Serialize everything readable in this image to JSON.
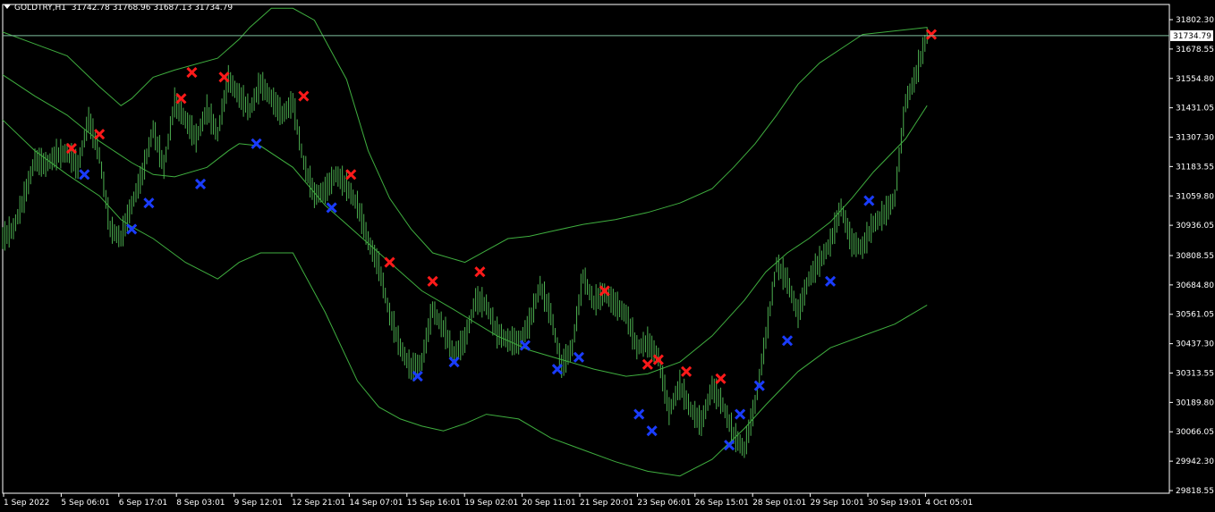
{
  "header": {
    "symbol": "GOLDTRY,H1",
    "ohlc": "31742.78 31768.96 31687.13 31734.79"
  },
  "colors": {
    "background": "#000000",
    "bars": "#4caf50",
    "bands": "#3fae3f",
    "sell_marker": "#ff1a1a",
    "buy_marker": "#1a3cff",
    "axis": "#ffffff",
    "price_line": "#7fbf9f"
  },
  "chart_data": {
    "type": "line",
    "title": "",
    "xlabel": "",
    "ylabel": "",
    "ylim": [
      29818.55,
      31802.3
    ],
    "current_price": "31734.79",
    "y_ticks": [
      "31802.30",
      "31678.55",
      "31554.80",
      "31431.05",
      "31307.30",
      "31183.55",
      "31059.80",
      "30936.05",
      "30808.55",
      "30684.80",
      "30561.05",
      "30437.30",
      "30313.55",
      "30189.80",
      "30066.05",
      "29942.30",
      "29818.55"
    ],
    "x_ticks": [
      "1 Sep 2022",
      "5 Sep 06:01",
      "6 Sep 17:01",
      "8 Sep 03:01",
      "9 Sep 12:01",
      "12 Sep 21:01",
      "14 Sep 07:01",
      "15 Sep 16:01",
      "19 Sep 02:01",
      "20 Sep 11:01",
      "21 Sep 20:01",
      "23 Sep 06:01",
      "26 Sep 15:01",
      "28 Sep 01:01",
      "29 Sep 10:01",
      "30 Sep 19:01",
      "4 Oct 05:01"
    ],
    "x_count": 160,
    "price": [
      [
        0,
        30880
      ],
      [
        5,
        30920
      ],
      [
        10,
        31050
      ],
      [
        15,
        31210
      ],
      [
        20,
        31190
      ],
      [
        25,
        31230
      ],
      [
        30,
        31240
      ],
      [
        35,
        31180
      ],
      [
        40,
        31380
      ],
      [
        45,
        31230
      ],
      [
        50,
        30920
      ],
      [
        55,
        30880
      ],
      [
        60,
        31020
      ],
      [
        65,
        31150
      ],
      [
        70,
        31340
      ],
      [
        75,
        31180
      ],
      [
        80,
        31450
      ],
      [
        85,
        31380
      ],
      [
        90,
        31300
      ],
      [
        95,
        31420
      ],
      [
        100,
        31320
      ],
      [
        105,
        31550
      ],
      [
        110,
        31480
      ],
      [
        115,
        31420
      ],
      [
        120,
        31530
      ],
      [
        125,
        31470
      ],
      [
        130,
        31400
      ],
      [
        135,
        31450
      ],
      [
        140,
        31200
      ],
      [
        145,
        31060
      ],
      [
        150,
        31080
      ],
      [
        155,
        31150
      ],
      [
        160,
        31100
      ],
      [
        165,
        31020
      ],
      [
        170,
        30870
      ],
      [
        175,
        30760
      ],
      [
        180,
        30560
      ],
      [
        185,
        30420
      ],
      [
        190,
        30330
      ],
      [
        195,
        30360
      ],
      [
        200,
        30580
      ],
      [
        205,
        30500
      ],
      [
        210,
        30390
      ],
      [
        215,
        30450
      ],
      [
        220,
        30620
      ],
      [
        225,
        30600
      ],
      [
        230,
        30480
      ],
      [
        235,
        30450
      ],
      [
        240,
        30440
      ],
      [
        245,
        30520
      ],
      [
        250,
        30680
      ],
      [
        255,
        30560
      ],
      [
        260,
        30340
      ],
      [
        265,
        30420
      ],
      [
        270,
        30720
      ],
      [
        275,
        30610
      ],
      [
        280,
        30650
      ],
      [
        285,
        30600
      ],
      [
        290,
        30560
      ],
      [
        295,
        30420
      ],
      [
        300,
        30440
      ],
      [
        305,
        30380
      ],
      [
        310,
        30150
      ],
      [
        315,
        30260
      ],
      [
        320,
        30160
      ],
      [
        325,
        30100
      ],
      [
        330,
        30250
      ],
      [
        335,
        30180
      ],
      [
        340,
        30050
      ],
      [
        345,
        29990
      ],
      [
        350,
        30180
      ],
      [
        355,
        30460
      ],
      [
        360,
        30770
      ],
      [
        365,
        30700
      ],
      [
        370,
        30560
      ],
      [
        375,
        30710
      ],
      [
        380,
        30780
      ],
      [
        385,
        30860
      ],
      [
        390,
        31010
      ],
      [
        395,
        30860
      ],
      [
        400,
        30840
      ],
      [
        405,
        30940
      ],
      [
        410,
        30980
      ],
      [
        415,
        31050
      ],
      [
        420,
        31450
      ],
      [
        425,
        31570
      ],
      [
        430,
        31735
      ]
    ],
    "bb_upper": [
      [
        0,
        31750
      ],
      [
        15,
        31700
      ],
      [
        30,
        31650
      ],
      [
        45,
        31520
      ],
      [
        55,
        31440
      ],
      [
        60,
        31470
      ],
      [
        70,
        31560
      ],
      [
        80,
        31590
      ],
      [
        100,
        31640
      ],
      [
        110,
        31720
      ],
      [
        115,
        31770
      ],
      [
        125,
        31850
      ],
      [
        135,
        31850
      ],
      [
        145,
        31800
      ],
      [
        160,
        31550
      ],
      [
        170,
        31250
      ],
      [
        180,
        31050
      ],
      [
        190,
        30920
      ],
      [
        200,
        30820
      ],
      [
        215,
        30780
      ],
      [
        225,
        30830
      ],
      [
        235,
        30880
      ],
      [
        245,
        30890
      ],
      [
        255,
        30910
      ],
      [
        270,
        30940
      ],
      [
        285,
        30960
      ],
      [
        300,
        30990
      ],
      [
        315,
        31030
      ],
      [
        330,
        31090
      ],
      [
        340,
        31180
      ],
      [
        350,
        31280
      ],
      [
        360,
        31400
      ],
      [
        370,
        31530
      ],
      [
        380,
        31620
      ],
      [
        390,
        31680
      ],
      [
        400,
        31740
      ],
      [
        430,
        31770
      ]
    ],
    "bb_mid": [
      [
        0,
        31570
      ],
      [
        15,
        31480
      ],
      [
        30,
        31400
      ],
      [
        45,
        31290
      ],
      [
        60,
        31200
      ],
      [
        70,
        31150
      ],
      [
        80,
        31140
      ],
      [
        95,
        31180
      ],
      [
        105,
        31250
      ],
      [
        110,
        31280
      ],
      [
        120,
        31270
      ],
      [
        135,
        31180
      ],
      [
        150,
        31020
      ],
      [
        165,
        30900
      ],
      [
        180,
        30780
      ],
      [
        195,
        30660
      ],
      [
        210,
        30580
      ],
      [
        230,
        30470
      ],
      [
        245,
        30410
      ],
      [
        260,
        30370
      ],
      [
        275,
        30330
      ],
      [
        290,
        30300
      ],
      [
        300,
        30310
      ],
      [
        315,
        30360
      ],
      [
        330,
        30470
      ],
      [
        345,
        30620
      ],
      [
        355,
        30740
      ],
      [
        365,
        30820
      ],
      [
        375,
        30880
      ],
      [
        385,
        30950
      ],
      [
        395,
        31050
      ],
      [
        405,
        31160
      ],
      [
        420,
        31300
      ],
      [
        430,
        31440
      ]
    ],
    "bb_lower": [
      [
        0,
        31380
      ],
      [
        15,
        31250
      ],
      [
        30,
        31150
      ],
      [
        45,
        31060
      ],
      [
        55,
        30960
      ],
      [
        60,
        30930
      ],
      [
        70,
        30880
      ],
      [
        85,
        30780
      ],
      [
        100,
        30710
      ],
      [
        110,
        30780
      ],
      [
        120,
        30820
      ],
      [
        135,
        30820
      ],
      [
        150,
        30570
      ],
      [
        165,
        30280
      ],
      [
        175,
        30170
      ],
      [
        185,
        30120
      ],
      [
        195,
        30090
      ],
      [
        205,
        30070
      ],
      [
        215,
        30100
      ],
      [
        225,
        30140
      ],
      [
        240,
        30120
      ],
      [
        255,
        30040
      ],
      [
        270,
        29990
      ],
      [
        285,
        29940
      ],
      [
        300,
        29900
      ],
      [
        315,
        29880
      ],
      [
        330,
        29950
      ],
      [
        345,
        30080
      ],
      [
        355,
        30180
      ],
      [
        370,
        30320
      ],
      [
        385,
        30420
      ],
      [
        400,
        30470
      ],
      [
        415,
        30520
      ],
      [
        430,
        30600
      ]
    ],
    "sell_markers": [
      [
        32,
        31260
      ],
      [
        45,
        31320
      ],
      [
        83,
        31470
      ],
      [
        88,
        31580
      ],
      [
        103,
        31560
      ],
      [
        140,
        31480
      ],
      [
        162,
        31150
      ],
      [
        180,
        30780
      ],
      [
        200,
        30700
      ],
      [
        222,
        30740
      ],
      [
        280,
        30660
      ],
      [
        300,
        30350
      ],
      [
        305,
        30370
      ],
      [
        318,
        30320
      ],
      [
        334,
        30290
      ],
      [
        432,
        31740
      ]
    ],
    "buy_markers": [
      [
        38,
        31150
      ],
      [
        60,
        30920
      ],
      [
        68,
        31030
      ],
      [
        92,
        31110
      ],
      [
        118,
        31280
      ],
      [
        153,
        31010
      ],
      [
        193,
        30300
      ],
      [
        210,
        30360
      ],
      [
        243,
        30430
      ],
      [
        258,
        30330
      ],
      [
        268,
        30380
      ],
      [
        296,
        30140
      ],
      [
        302,
        30070
      ],
      [
        338,
        30010
      ],
      [
        343,
        30140
      ],
      [
        352,
        30260
      ],
      [
        365,
        30450
      ],
      [
        385,
        30700
      ],
      [
        403,
        31040
      ]
    ]
  }
}
